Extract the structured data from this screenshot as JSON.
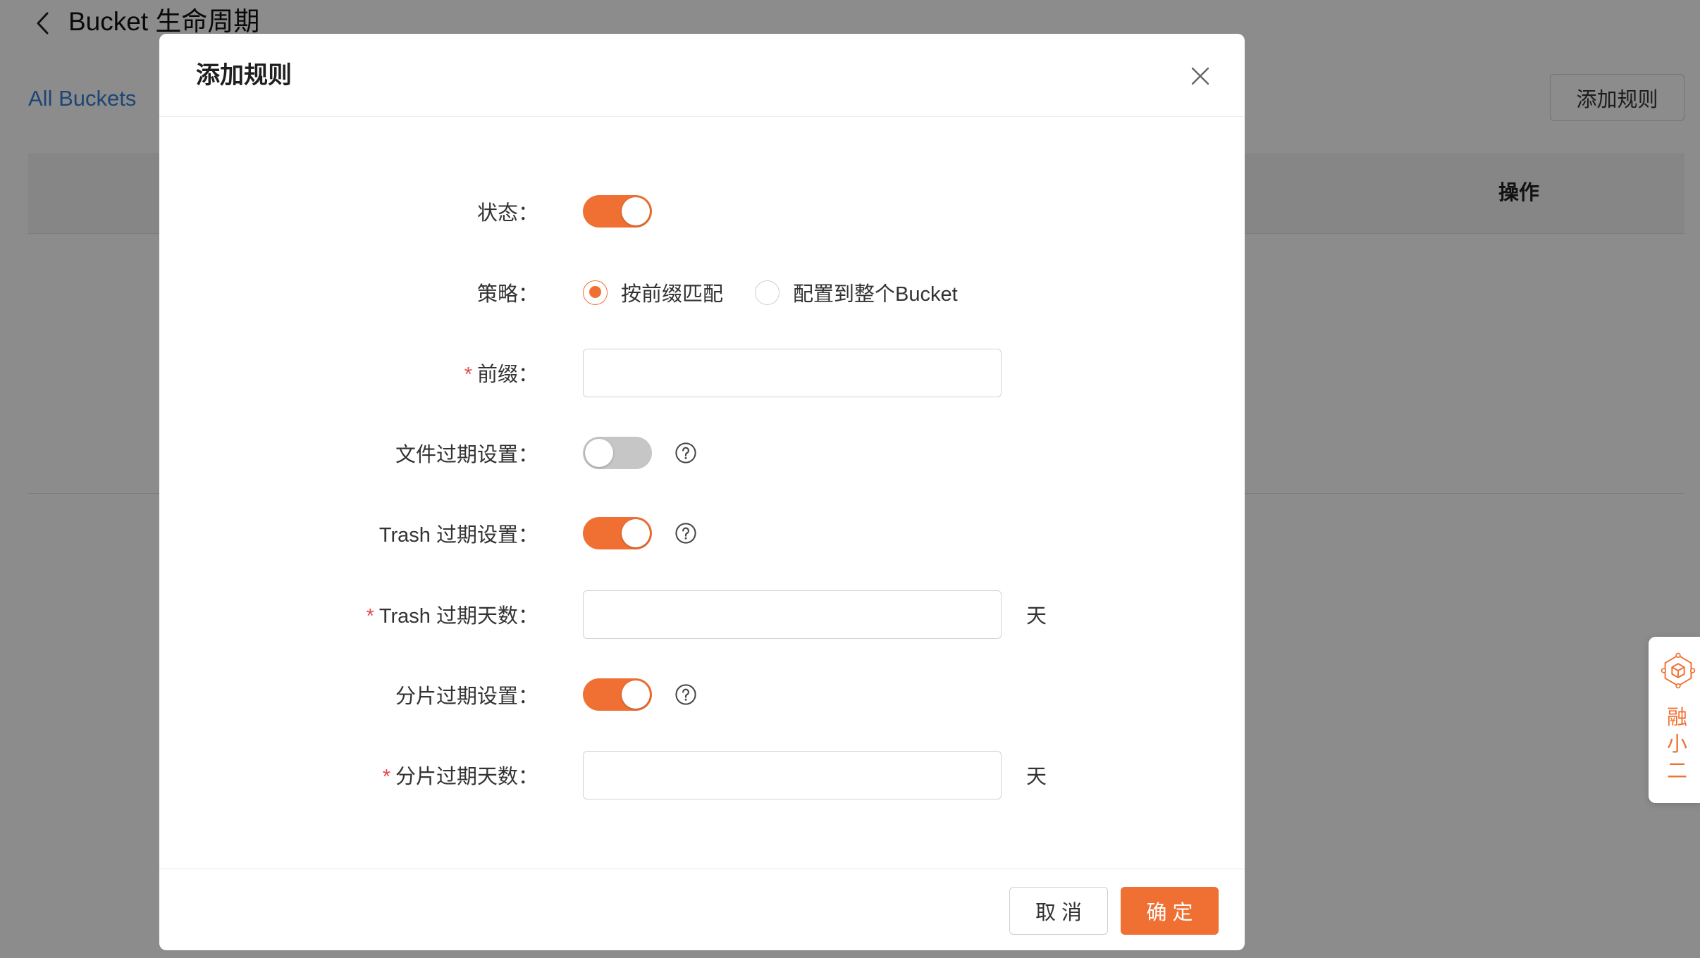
{
  "page": {
    "title": "Bucket 生命周期",
    "breadcrumb": {
      "all_buckets": "All Buckets"
    },
    "add_rule_button": "添加规则",
    "table": {
      "columns": {
        "actions": "操作"
      }
    }
  },
  "modal": {
    "title": "添加规则",
    "fields": {
      "status": {
        "label": "状态：",
        "enabled": true
      },
      "strategy": {
        "label": "策略：",
        "options": [
          {
            "label": "按前缀匹配",
            "checked": true
          },
          {
            "label": "配置到整个Bucket",
            "checked": false
          }
        ]
      },
      "prefix": {
        "required_mark": "*",
        "label": "前缀：",
        "value": ""
      },
      "file_expiry": {
        "label": "文件过期设置：",
        "enabled": false
      },
      "trash_expiry": {
        "label": "Trash 过期设置：",
        "enabled": true
      },
      "trash_days": {
        "required_mark": "*",
        "label": "Trash 过期天数：",
        "value": "",
        "unit": "天"
      },
      "multipart_expiry": {
        "label": "分片过期设置：",
        "enabled": true
      },
      "multipart_days": {
        "required_mark": "*",
        "label": "分片过期天数：",
        "value": "",
        "unit": "天"
      }
    },
    "footer": {
      "cancel_label": "取 消",
      "confirm_label": "确 定"
    }
  },
  "assistant_widget": {
    "label_chars": [
      "融",
      "小",
      "二"
    ]
  },
  "icons": {
    "back": "chevron-left-icon",
    "close": "close-icon",
    "help": "question-circle-icon",
    "assistant": "cube-icon"
  },
  "colors": {
    "accent": "#f07033",
    "required": "#e5484d",
    "link": "#3a7fd5"
  }
}
